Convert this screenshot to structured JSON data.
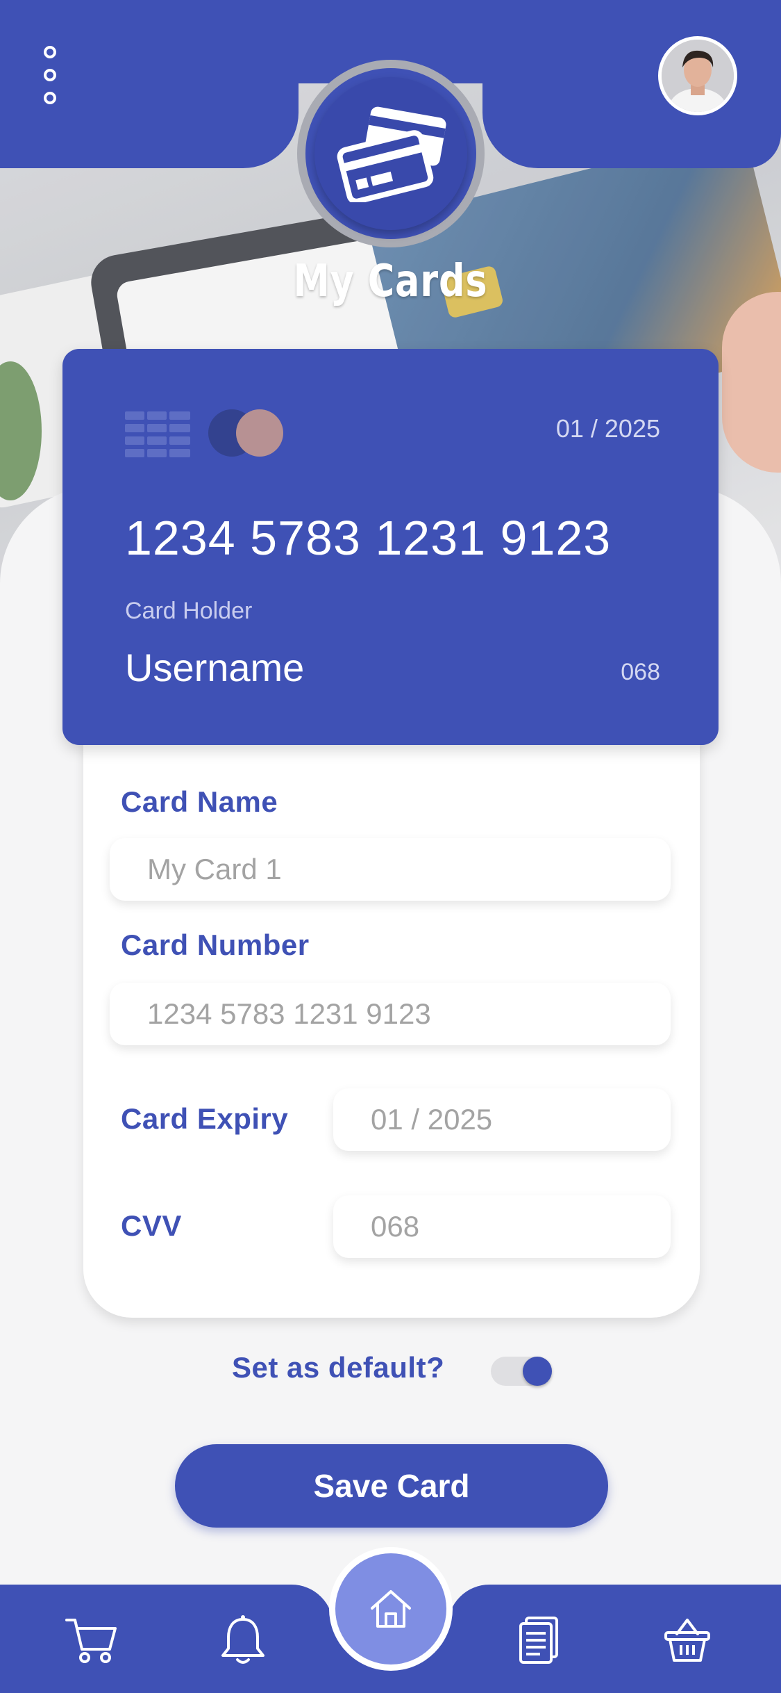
{
  "header": {
    "title": "My Cards",
    "menu_icon": "more-vertical-icon",
    "avatar_icon": "user-avatar",
    "badge_icon": "credit-cards-icon"
  },
  "card_preview": {
    "expiry": "01 / 2025",
    "number": "1234 5783 1231 9123",
    "holder_label": "Card Holder",
    "holder_name": "Username",
    "cvv": "068",
    "chip_icon": "card-chip-icon",
    "brand_icon": "card-brand-icon"
  },
  "form": {
    "card_name": {
      "label": "Card Name",
      "placeholder": "My Card 1"
    },
    "card_number": {
      "label": "Card Number",
      "placeholder": "1234 5783 1231 9123"
    },
    "card_expiry": {
      "label": "Card Expiry",
      "placeholder": "01 / 2025"
    },
    "cvv": {
      "label": "CVV",
      "placeholder": "068"
    }
  },
  "default_toggle": {
    "label": "Set as default?",
    "on": true
  },
  "save_button": {
    "label": "Save Card"
  },
  "bottom_nav": {
    "items": [
      {
        "icon": "cart-icon"
      },
      {
        "icon": "bell-icon"
      },
      {
        "icon": "home-icon",
        "active": true
      },
      {
        "icon": "document-icon"
      },
      {
        "icon": "basket-icon"
      }
    ]
  },
  "colors": {
    "primary": "#3f51b5",
    "primary_light": "#7f8ee3",
    "background": "#f5f5f6",
    "placeholder": "#a3a3a3"
  }
}
